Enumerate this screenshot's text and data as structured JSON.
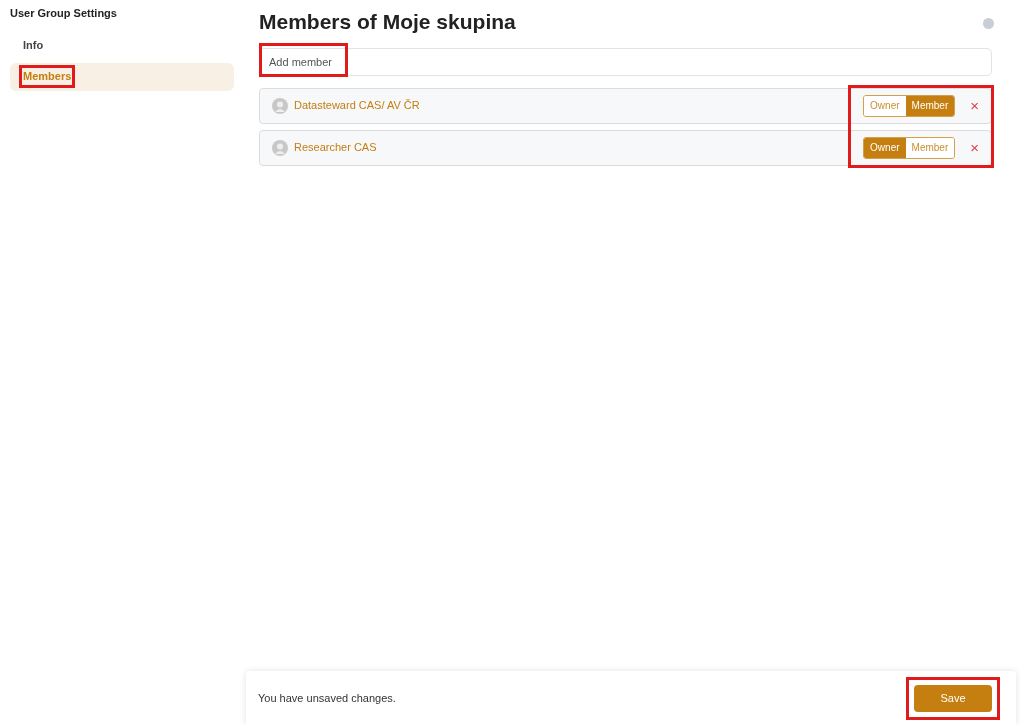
{
  "sidebar": {
    "title": "User Group Settings",
    "items": [
      {
        "label": "Info",
        "selected": false,
        "highlighted": false
      },
      {
        "label": "Members",
        "selected": true,
        "highlighted": true
      }
    ]
  },
  "page": {
    "title": "Members of Moje skupina"
  },
  "add_member": {
    "placeholder": "Add member",
    "highlighted": true
  },
  "members": {
    "roles_highlighted": true,
    "rows": [
      {
        "name": "Datasteward CAS/ AV ČR",
        "roles": [
          {
            "label": "Owner",
            "selected": false
          },
          {
            "label": "Member",
            "selected": true
          }
        ],
        "remove": "×"
      },
      {
        "name": "Researcher CAS",
        "roles": [
          {
            "label": "Owner",
            "selected": true
          },
          {
            "label": "Member",
            "selected": false
          }
        ],
        "remove": "×"
      }
    ]
  },
  "footer": {
    "message": "You have unsaved changes.",
    "save": {
      "label": "Save",
      "highlighted": true
    }
  }
}
